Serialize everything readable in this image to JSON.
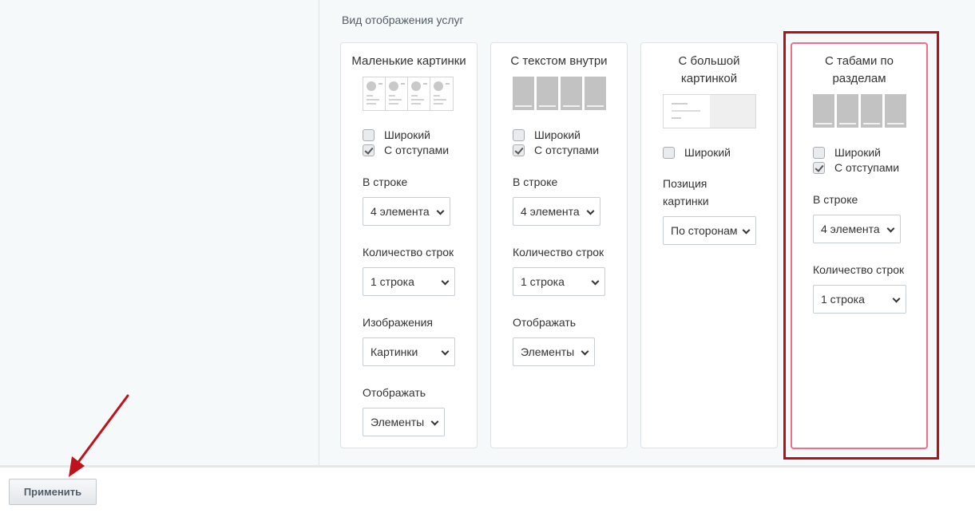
{
  "section_title": "Вид отображения услуг",
  "cards": [
    {
      "title": "Маленькие картинки",
      "checkboxes": [
        {
          "label": "Широкий",
          "checked": false
        },
        {
          "label": "С отступами",
          "checked": true
        }
      ],
      "fields": [
        {
          "label": "В строке",
          "value": "4 элемента"
        },
        {
          "label": "Количество строк",
          "value": "1 строка"
        },
        {
          "label": "Изображения",
          "value": "Картинки"
        },
        {
          "label": "Отображать",
          "value": "Элементы"
        }
      ]
    },
    {
      "title": "С текстом внутри",
      "checkboxes": [
        {
          "label": "Широкий",
          "checked": false
        },
        {
          "label": "С отступами",
          "checked": true
        }
      ],
      "fields": [
        {
          "label": "В строке",
          "value": "4 элемента"
        },
        {
          "label": "Количество строк",
          "value": "1 строка"
        },
        {
          "label": "Отображать",
          "value": "Элементы"
        }
      ]
    },
    {
      "title_line1": "С большой",
      "title_line2": "картинкой",
      "checkboxes": [
        {
          "label": "Широкий",
          "checked": false
        }
      ],
      "fields": [
        {
          "label_line1": "Позиция",
          "label_line2": "картинки",
          "value": "По сторонам"
        }
      ]
    },
    {
      "title_line1": "С табами по",
      "title_line2": "разделам",
      "checkboxes": [
        {
          "label": "Широкий",
          "checked": false
        },
        {
          "label": "С отступами",
          "checked": true
        }
      ],
      "fields": [
        {
          "label": "В строке",
          "value": "4 элемента"
        },
        {
          "label": "Количество строк",
          "value": "1 строка"
        }
      ]
    }
  ],
  "footer": {
    "apply_label": "Применить"
  },
  "colors": {
    "highlight": "#b80f17",
    "selected_card_border": "#f06e8a",
    "arrow": "#c0121b"
  }
}
